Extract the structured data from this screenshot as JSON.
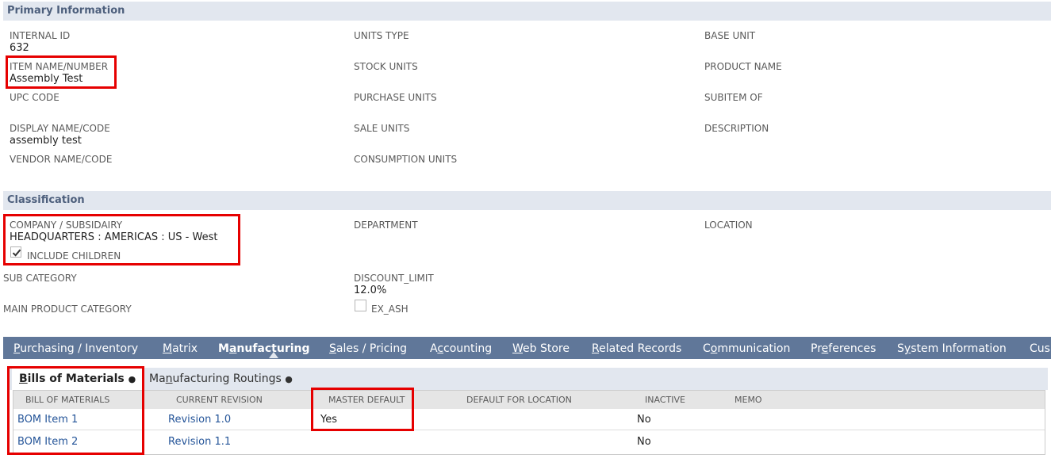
{
  "primary": {
    "title": "Primary Information",
    "fields": {
      "internal_id": {
        "label": "INTERNAL ID",
        "value": "632"
      },
      "item_name": {
        "label": "ITEM NAME/NUMBER",
        "value": "Assembly Test"
      },
      "upc_code": {
        "label": "UPC CODE",
        "value": ""
      },
      "display_name": {
        "label": "DISPLAY NAME/CODE",
        "value": "assembly test"
      },
      "vendor_name": {
        "label": "VENDOR NAME/CODE",
        "value": ""
      },
      "units_type": {
        "label": "UNITS TYPE",
        "value": ""
      },
      "stock_units": {
        "label": "STOCK UNITS",
        "value": ""
      },
      "purchase_units": {
        "label": "PURCHASE UNITS",
        "value": ""
      },
      "sale_units": {
        "label": "SALE UNITS",
        "value": ""
      },
      "consumption_units": {
        "label": "CONSUMPTION UNITS",
        "value": ""
      },
      "base_unit": {
        "label": "BASE UNIT",
        "value": ""
      },
      "product_name": {
        "label": "PRODUCT NAME",
        "value": ""
      },
      "subitem_of": {
        "label": "SUBITEM OF",
        "value": ""
      },
      "description": {
        "label": "DESCRIPTION",
        "value": ""
      }
    }
  },
  "classification": {
    "title": "Classification",
    "company": {
      "label": "COMPANY / SUBSIDAIRY",
      "value": "HEADQUARTERS : AMERICAS : US - West"
    },
    "include_children": {
      "label": "INCLUDE CHILDREN",
      "checked": true
    },
    "department": {
      "label": "DEPARTMENT",
      "value": ""
    },
    "location": {
      "label": "LOCATION",
      "value": ""
    },
    "sub_category": {
      "label": "SUB CATEGORY",
      "value": ""
    },
    "main_product_category": {
      "label": "MAIN PRODUCT CATEGORY",
      "value": ""
    },
    "discount_limit": {
      "label": "DISCOUNT_LIMIT",
      "value": "12.0%"
    },
    "ex_ash": {
      "label": "EX_ASH",
      "checked": false
    }
  },
  "tabs": [
    {
      "label": "Purchasing / Inventory",
      "underline": "P",
      "rest": "urchasing / Inventory",
      "active": false
    },
    {
      "label": "Matrix",
      "underline": "M",
      "rest": "atrix",
      "active": false
    },
    {
      "label": "Manufacturing",
      "pre": "M",
      "underline": "a",
      "rest": "nufacturing",
      "active": true
    },
    {
      "label": "Sales / Pricing",
      "underline": "S",
      "rest": "ales / Pricing",
      "active": false
    },
    {
      "label": "Accounting",
      "pre": "A",
      "underline": "c",
      "rest": "counting",
      "active": false
    },
    {
      "label": "Web Store",
      "underline": "W",
      "rest": "eb Store",
      "active": false
    },
    {
      "label": "Related Records",
      "underline": "R",
      "rest": "elated Records",
      "active": false
    },
    {
      "label": "Communication",
      "pre": "C",
      "underline": "o",
      "rest": "mmunication",
      "active": false
    },
    {
      "label": "Preferences",
      "pre": "Pr",
      "underline": "e",
      "rest": "ferences",
      "active": false
    },
    {
      "label": "System Information",
      "pre": "S",
      "underline": "y",
      "rest": "stem Information",
      "active": false
    },
    {
      "label": "Cus",
      "underline": "",
      "rest": "Cus",
      "active": false
    }
  ],
  "subtabs": [
    {
      "pre": "",
      "underline": "B",
      "rest": "ills of Materials",
      "dot": "●",
      "active": true
    },
    {
      "pre": "Ma",
      "underline": "n",
      "rest": "ufacturing Routings",
      "dot": "●",
      "active": false
    }
  ],
  "bom_table": {
    "headers": [
      "BILL OF MATERIALS",
      "CURRENT REVISION",
      "MASTER DEFAULT",
      "DEFAULT FOR LOCATION",
      "INACTIVE",
      "MEMO"
    ],
    "rows": [
      {
        "bom": "BOM Item 1",
        "revision": "Revision 1.0",
        "master_default": "Yes",
        "default_location": "",
        "inactive": "No",
        "memo": ""
      },
      {
        "bom": "BOM Item 2",
        "revision": "Revision 1.1",
        "master_default": "",
        "default_location": "",
        "inactive": "No",
        "memo": ""
      }
    ]
  },
  "colors": {
    "section_bar": "#e2e7ef",
    "tab_bar": "#607799",
    "highlight": "#e60000",
    "link": "#255599"
  }
}
